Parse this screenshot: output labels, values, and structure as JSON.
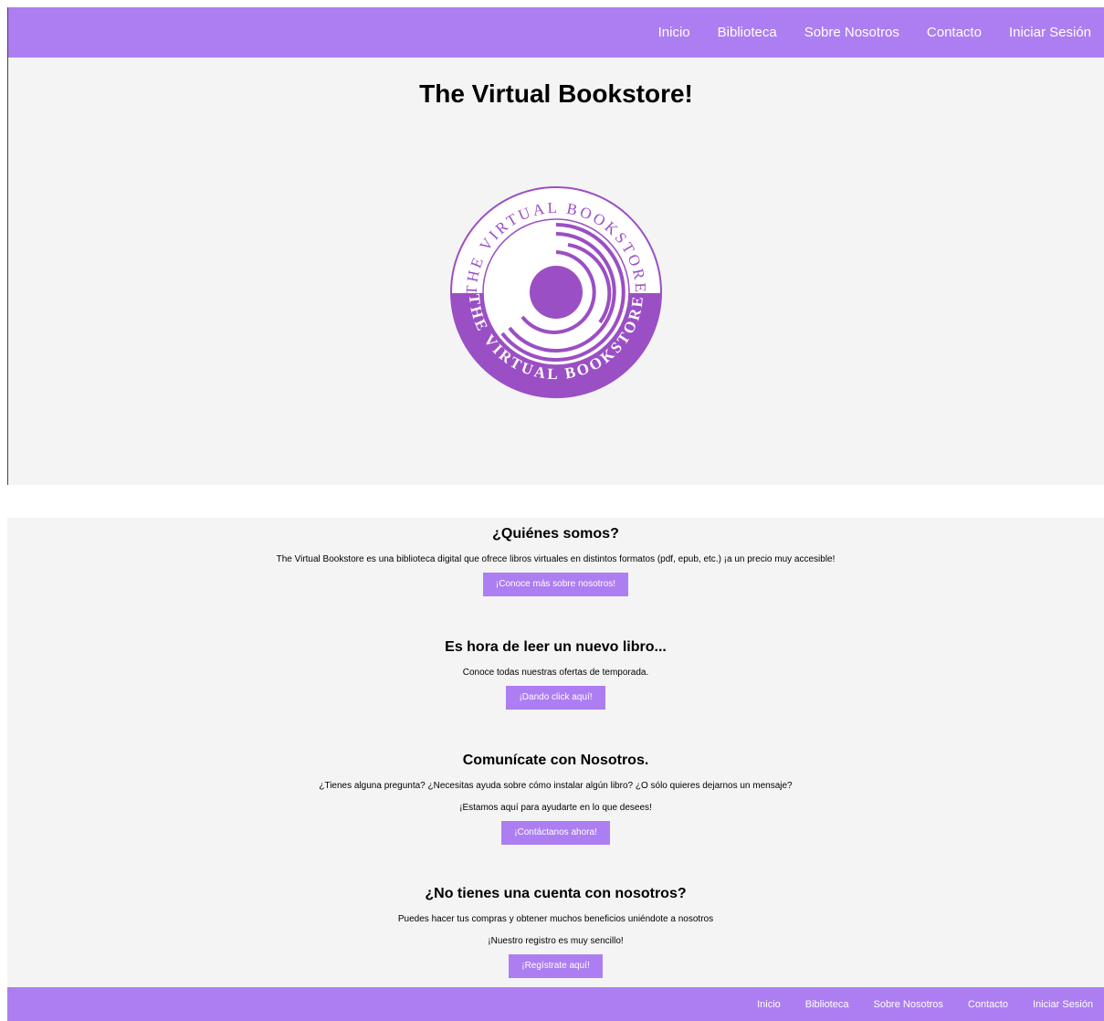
{
  "nav": {
    "items": [
      "Inicio",
      "Biblioteca",
      "Sobre Nosotros",
      "Contacto",
      "Iniciar Sesión"
    ]
  },
  "hero": {
    "title": "The Virtual Bookstore!",
    "logo": {
      "top_text": "THE VIRTUAL BOOKSTORE",
      "bottom_text": "THE VIRTUAL BOOKSTORE",
      "accent_color": "#9b4fc4"
    }
  },
  "sections": {
    "about": {
      "title": "¿Quiénes somos?",
      "text": "The Virtual Bookstore es una biblioteca digital que ofrece libros virtuales en distintos formatos (pdf, epub, etc.) ¡a un precio muy accesible!",
      "button": "¡Conoce más sobre nosotros!"
    },
    "offers": {
      "title": "Es hora de leer un nuevo libro...",
      "text": "Conoce todas nuestras ofertas de temporada.",
      "button": "¡Dando click aquí!"
    },
    "contact": {
      "title": "Comunícate con Nosotros.",
      "text1": "¿Tienes alguna pregunta? ¿Necesitas ayuda sobre cómo instalar algún libro? ¿O sólo quieres dejarnos un mensaje?",
      "text2": "¡Estamos aquí para ayudarte en lo que desees!",
      "button": "¡Contáctanos ahora!"
    },
    "register": {
      "title": "¿No tienes una cuenta con nosotros?",
      "text1": "Puedes hacer tus compras y obtener muchos beneficios uniéndote a nosotros",
      "text2": "¡Nuestro registro es muy sencillo!",
      "button": "¡Regístrate aquí!"
    }
  },
  "footer": {
    "items": [
      "Inicio",
      "Biblioteca",
      "Sobre Nosotros",
      "Contacto",
      "Iniciar Sesión"
    ]
  },
  "colors": {
    "accent": "#ad7ef1",
    "background": "#f4f4f4",
    "logo_purple": "#9b4fc4"
  }
}
